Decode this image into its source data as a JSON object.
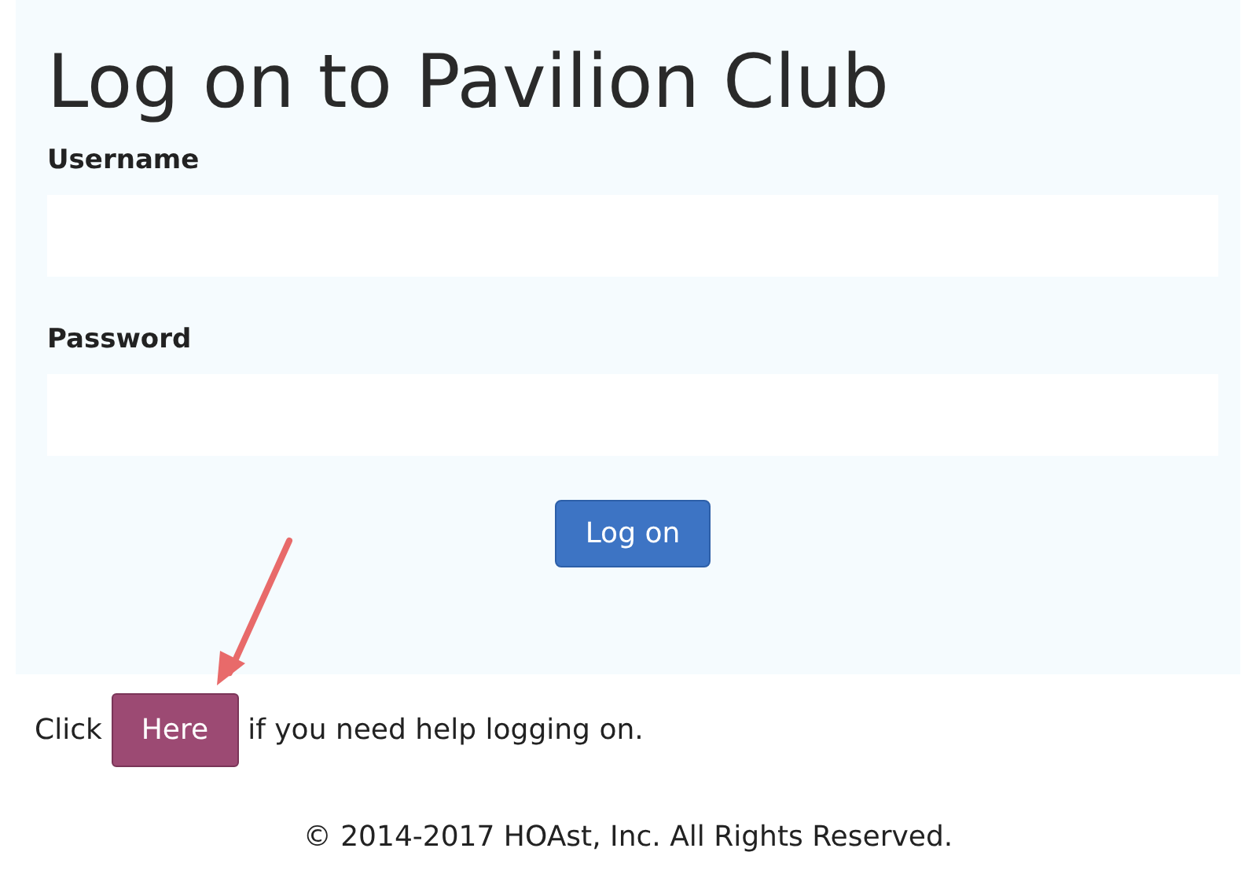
{
  "title": "Log on to Pavilion Club",
  "fields": [
    {
      "label": "Username"
    },
    {
      "label": "Password"
    }
  ],
  "login_button": "Log on",
  "help": {
    "before": "Click",
    "button": "Here",
    "after": "if you need help logging on."
  },
  "footer": "© 2014-2017 HOAst, Inc. All Rights Reserved."
}
